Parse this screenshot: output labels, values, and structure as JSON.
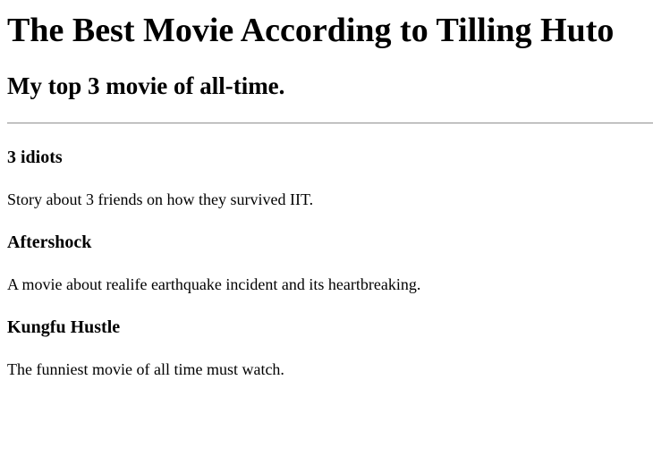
{
  "page": {
    "title": "The Best Movie According to Tilling Huto",
    "subtitle": "My top 3 movie of all-time."
  },
  "movies": [
    {
      "name": "3 idiots",
      "description": "Story about 3 friends on how they survived IIT."
    },
    {
      "name": "Aftershock",
      "description": "A movie about realife earthquake incident and its heartbreaking."
    },
    {
      "name": "Kungfu Hustle",
      "description": "The funniest movie of all time must watch."
    }
  ]
}
